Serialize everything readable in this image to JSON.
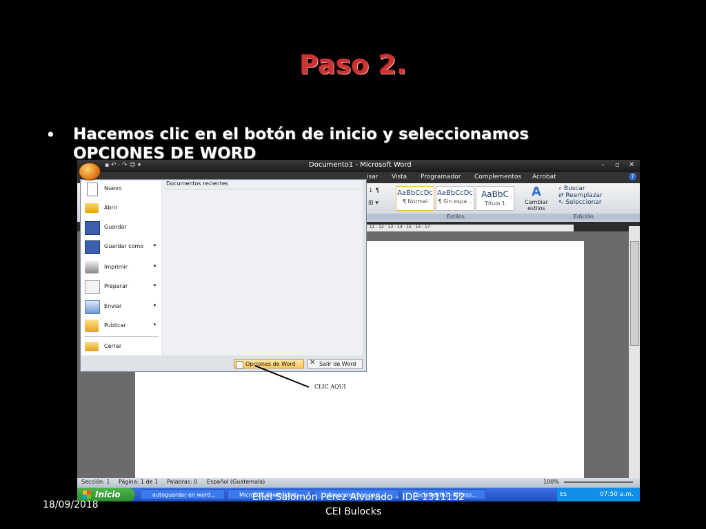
{
  "slide": {
    "title": "Paso 2.",
    "bullet_symbol": "•",
    "bullet_text": "Hacemos clic en el botón de inicio y seleccionamos OPCIONES DE WORD",
    "annotation": "CLIC AQUI",
    "footer_date": "18/09/2018",
    "footer_author": "Eliel Salomón Pérez Alvarado - IDE 1311152",
    "footer_org": "CEI Bulocks"
  },
  "word": {
    "window_title": "Documento1 - Microsoft Word",
    "ribbon_tabs": [
      "isar",
      "Vista",
      "Programador",
      "Complementos",
      "Acrobat"
    ],
    "styles": [
      {
        "preview": "AaBbCcDc",
        "name": "¶ Normal"
      },
      {
        "preview": "AaBbCcDc",
        "name": "¶ Sin espa..."
      },
      {
        "preview": "AaBbC",
        "name": "Título 1"
      }
    ],
    "change_styles_label": "Cambiar estilos",
    "group_styles_label": "Estilos",
    "group_edit_label": "Edición",
    "edit_items": [
      "Buscar",
      "Reemplazar",
      "Seleccionar"
    ],
    "ruler_text": "· 11 · 12 · 13 · 14 · 15 · 16 · 17 ·",
    "office_menu": {
      "recent_title": "Documentos recientes",
      "items": [
        "Nuevo",
        "Abrir",
        "Guardar",
        "Guardar como",
        "Imprimir",
        "Preparar",
        "Enviar",
        "Publicar",
        "Cerrar"
      ],
      "opciones_button": "Opciones de Word",
      "salir_button": "Salir de Word"
    },
    "status": {
      "seccion": "Sección: 1",
      "pagina": "Página: 1 de 1",
      "palabras": "Palabras: 0",
      "idioma": "Español (Guatemala)",
      "zoom": "100%"
    },
    "taskbar": {
      "start_label": "Inicio",
      "tasks": [
        "autoguardar en word...",
        "Microsoft PowerPoint...",
        "seleccionamos opci...",
        "Documento1 - Micros..."
      ],
      "lang": "ES",
      "clock": "07:50 a.m."
    }
  }
}
